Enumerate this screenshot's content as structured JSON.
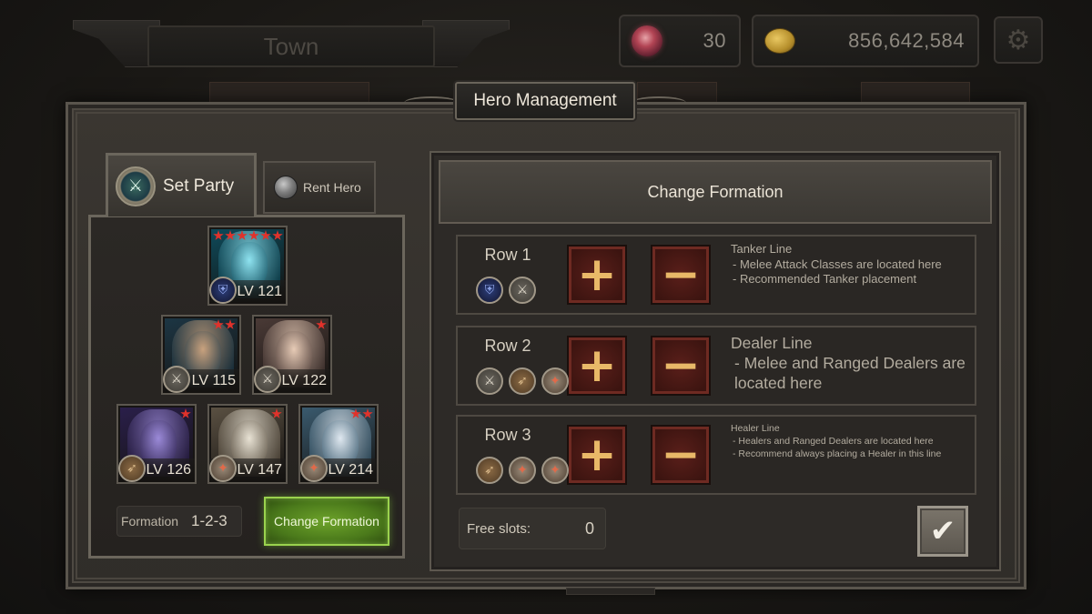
{
  "top_bar": {
    "location_title": "Town",
    "gems": "30",
    "gold": "856,642,584",
    "gem_icon": "crystal-gem-icon",
    "gold_icon": "gold-coin-icon",
    "settings_icon": "gear-icon"
  },
  "dialog": {
    "title": "Hero Management"
  },
  "tabs": {
    "set_party": "Set Party",
    "rent_hero": "Rent Hero"
  },
  "party": {
    "heroes": [
      {
        "level": "LV 121",
        "stars": 6,
        "class": "shield",
        "palette": [
          "#0e4a5a",
          "#8fe3f0"
        ]
      },
      {
        "level": "LV 115",
        "stars": 2,
        "class": "sword",
        "palette": [
          "#1d3644",
          "#c9a27e"
        ]
      },
      {
        "level": "LV 122",
        "stars": 1,
        "class": "sword",
        "palette": [
          "#4a3a36",
          "#e7cbb6"
        ]
      },
      {
        "level": "LV 126",
        "stars": 1,
        "class": "bow",
        "palette": [
          "#2a1f4a",
          "#9b8ad8"
        ]
      },
      {
        "level": "LV 147",
        "stars": 1,
        "class": "staff",
        "palette": [
          "#5a5042",
          "#e8e2d4"
        ]
      },
      {
        "level": "LV 214",
        "stars": 2,
        "class": "staff",
        "palette": [
          "#3a5a6e",
          "#dfe8f0"
        ]
      }
    ],
    "formation_label": "Formation",
    "formation_value": "1-2-3",
    "change_formation_button": "Change Formation"
  },
  "formation_panel": {
    "header": "Change Formation",
    "rows": [
      {
        "label": "Row 1",
        "icons": [
          "shield",
          "sword"
        ],
        "title": "Tanker Line",
        "lines": [
          "- Melee Attack Classes are located here",
          "- Recommended Tanker placement"
        ]
      },
      {
        "label": "Row 2",
        "icons": [
          "sword",
          "bow",
          "staff"
        ],
        "title": "Dealer Line",
        "lines": [
          "- Melee and Ranged Dealers are located here"
        ]
      },
      {
        "label": "Row 3",
        "icons": [
          "bow",
          "staff",
          "staff"
        ],
        "title": "Healer Line",
        "lines": [
          "- Healers and Ranged Dealers are located here",
          "- Recommend always placing a Healer in this line"
        ]
      }
    ],
    "plus_symbol": "+",
    "minus_symbol": "−",
    "free_slots_label": "Free slots:",
    "free_slots_value": "0",
    "confirm_icon": "checkmark-icon"
  }
}
